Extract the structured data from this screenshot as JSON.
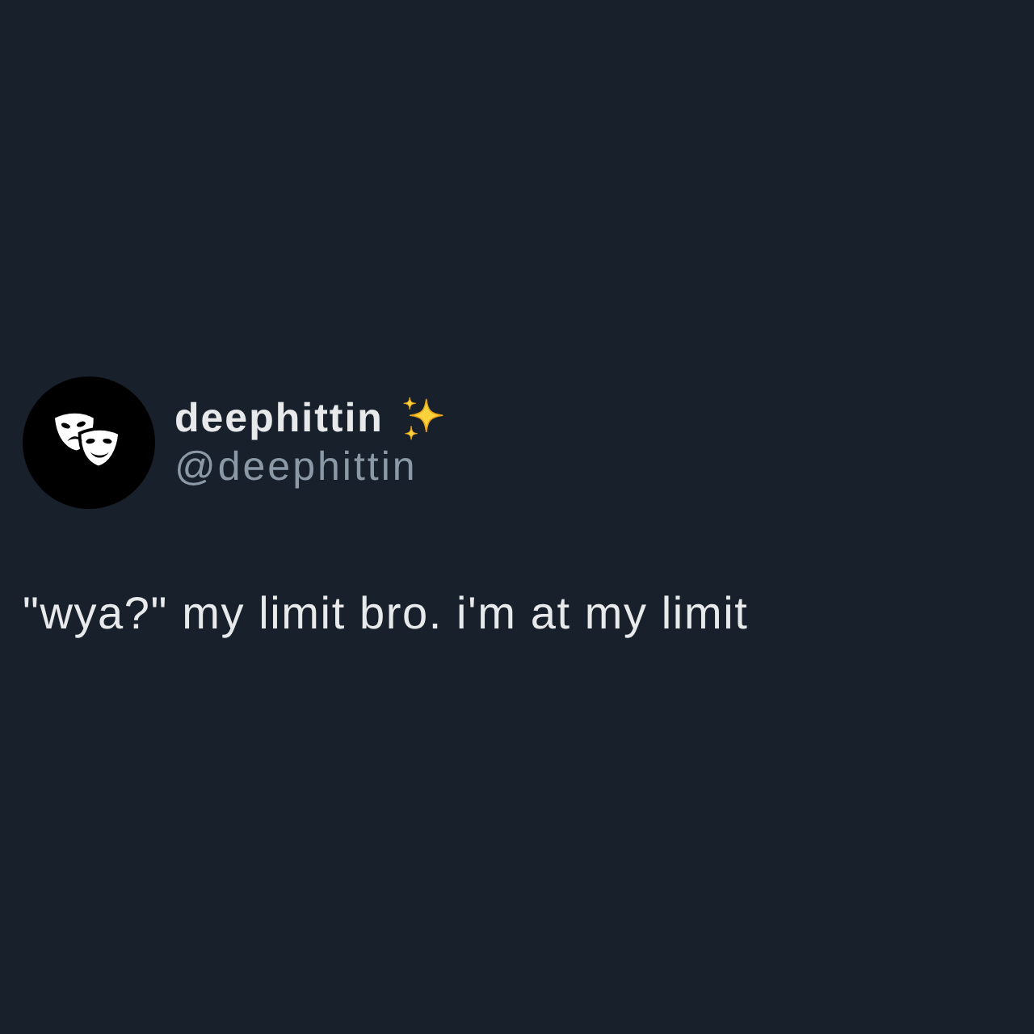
{
  "post": {
    "author": {
      "display_name": "deephittin",
      "handle": "@deephittin"
    },
    "text": "\"wya?\" my limit bro. i'm at my limit"
  }
}
